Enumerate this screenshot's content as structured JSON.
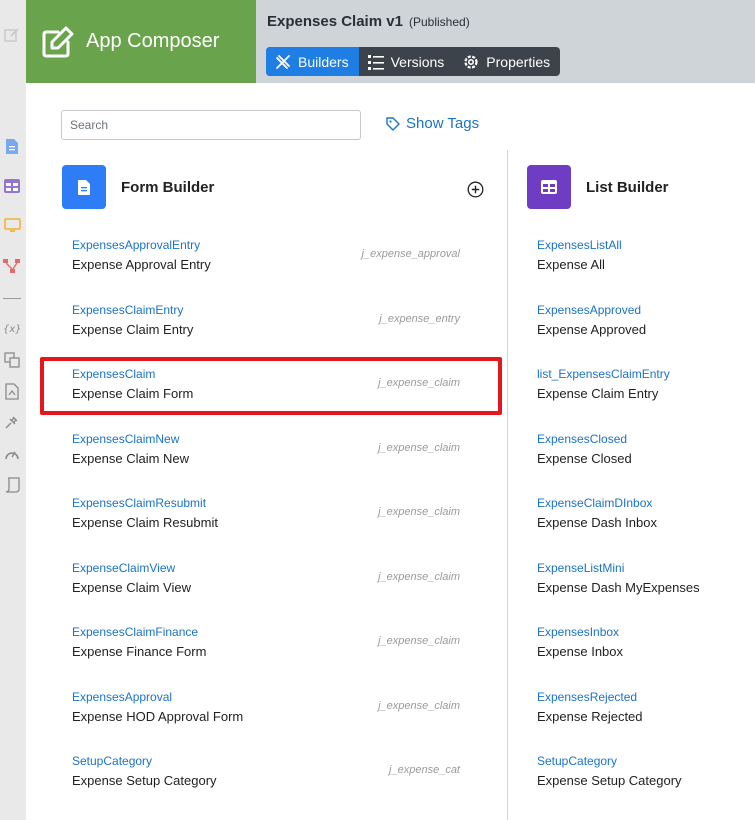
{
  "brand": {
    "title": "App Composer"
  },
  "app": {
    "name": "Expenses Claim v1",
    "status": "(Published)"
  },
  "tabs": [
    {
      "label": "Builders",
      "icon": "tools-icon",
      "active": true
    },
    {
      "label": "Versions",
      "icon": "list-icon",
      "active": false
    },
    {
      "label": "Properties",
      "icon": "gear-icon",
      "active": false
    }
  ],
  "search": {
    "placeholder": "Search",
    "value": ""
  },
  "show_tags": {
    "label": "Show Tags"
  },
  "rail_icons": [
    "edit-icon",
    "form-icon",
    "table-icon",
    "screen-icon",
    "flow-icon",
    "variable-icon",
    "translate-icon",
    "report-icon",
    "plugin-icon",
    "dashboard-icon",
    "script-icon"
  ],
  "form_builder": {
    "title": "Form Builder",
    "items": [
      {
        "code": "ExpensesApprovalEntry",
        "label": "Expense Approval Entry",
        "table": "j_expense_approval"
      },
      {
        "code": "ExpensesClaimEntry",
        "label": "Expense Claim Entry",
        "table": "j_expense_entry"
      },
      {
        "code": "ExpensesClaim",
        "label": "Expense Claim Form",
        "table": "j_expense_claim"
      },
      {
        "code": "ExpensesClaimNew",
        "label": "Expense Claim New",
        "table": "j_expense_claim"
      },
      {
        "code": "ExpensesClaimResubmit",
        "label": "Expense Claim Resubmit",
        "table": "j_expense_claim"
      },
      {
        "code": "ExpenseClaimView",
        "label": "Expense Claim View",
        "table": "j_expense_claim"
      },
      {
        "code": "ExpensesClaimFinance",
        "label": "Expense Finance Form",
        "table": "j_expense_claim"
      },
      {
        "code": "ExpensesApproval",
        "label": "Expense HOD Approval Form",
        "table": "j_expense_claim"
      },
      {
        "code": "SetupCategory",
        "label": "Expense Setup Category",
        "table": "j_expense_cat"
      }
    ]
  },
  "list_builder": {
    "title": "List Builder",
    "items": [
      {
        "code": "ExpensesListAll",
        "label": "Expense All"
      },
      {
        "code": "ExpensesApproved",
        "label": "Expense Approved"
      },
      {
        "code": "list_ExpensesClaimEntry",
        "label": "Expense Claim Entry"
      },
      {
        "code": "ExpensesClosed",
        "label": "Expense Closed"
      },
      {
        "code": "ExpenseClaimDInbox",
        "label": "Expense Dash Inbox"
      },
      {
        "code": "ExpenseListMini",
        "label": "Expense Dash MyExpenses"
      },
      {
        "code": "ExpensesInbox",
        "label": "Expense Inbox"
      },
      {
        "code": "ExpensesRejected",
        "label": "Expense Rejected"
      },
      {
        "code": "SetupCategory",
        "label": "Expense Setup Category"
      }
    ]
  },
  "colors": {
    "brand": "#69a34b",
    "header": "#cfd4d9",
    "tab_active": "#1f7ee3",
    "link": "#1a73c8",
    "form_icon_bg": "#2f7df6",
    "list_icon_bg": "#6f3cc4",
    "highlight": "#e5161c"
  }
}
